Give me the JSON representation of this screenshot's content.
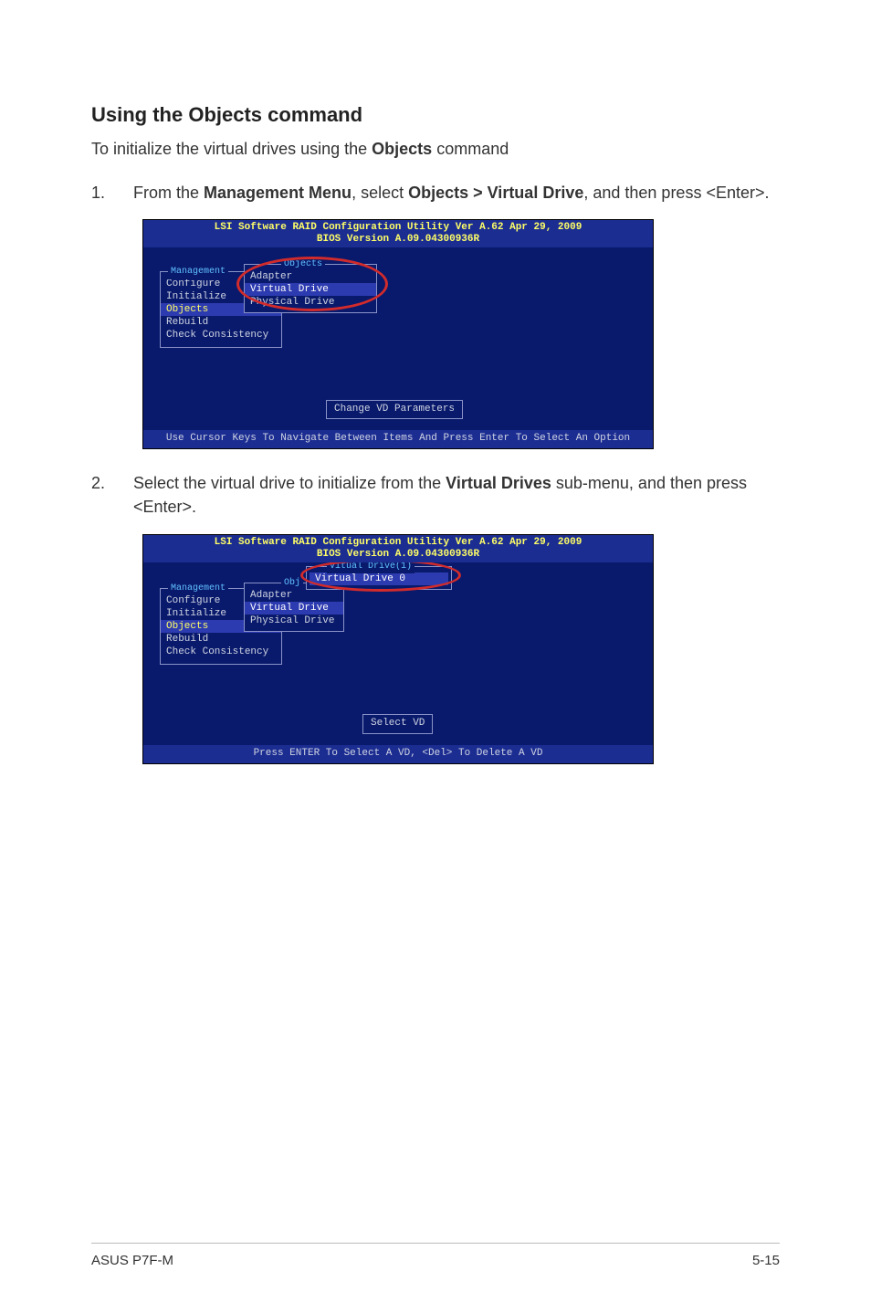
{
  "heading": "Using the Objects command",
  "intro_pre": "To initialize the virtual drives using the ",
  "intro_bold": "Objects",
  "intro_post": " command",
  "step1": {
    "num": "1.",
    "pre": "From the ",
    "b1": "Management Menu",
    "mid": ", select ",
    "b2": "Objects > Virtual Drive",
    "post1": ", and then press <Enter>."
  },
  "step2": {
    "num": "2.",
    "pre": "Select the virtual drive to initialize from the ",
    "b1": "Virtual Drives",
    "post": " sub-menu, and then press <Enter>."
  },
  "bios_header_line1": "LSI Software RAID Configuration Utility Ver A.62 Apr 29, 2009",
  "bios_header_line2": "BIOS Version   A.09.04300936R",
  "mgmt_legend": "Management",
  "mgmt_items": {
    "i0": "Configure",
    "i1": "Initialize",
    "i2": "Objects",
    "i3": "Rebuild",
    "i4": "Check Consistency"
  },
  "objects_legend": "Objects",
  "obj_short_legend": "Obj",
  "objects_items": {
    "i0": "Adapter",
    "i1": "Virtual Drive",
    "i2": "Physical Drive"
  },
  "vd_panel_legend": "Vitual Drive(1)",
  "vd_item0": "Virtual Drive 0",
  "hint1": "Change VD Parameters",
  "footer1": "Use Cursor Keys To Navigate Between Items And Press Enter To Select An Option",
  "hint2": "Select VD",
  "footer2": "Press ENTER To Select A VD, <Del> To Delete A VD",
  "page_footer_left": "ASUS P7F-M",
  "page_footer_right": "5-15"
}
